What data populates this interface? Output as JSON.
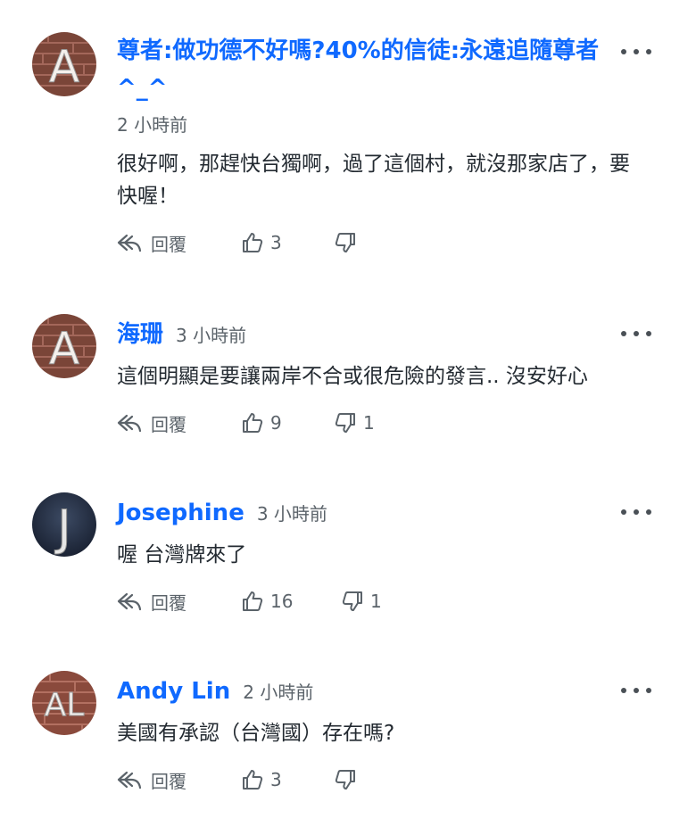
{
  "ui": {
    "reply_label": "回覆"
  },
  "comments": [
    {
      "author": "尊者:做功德不好嗎?40%的信徒:永遠追隨尊者^_^",
      "time": "2 小時前",
      "text": "很好啊，那趕快台獨啊，過了這個村，就沒那家店了，要快喔！",
      "likes": "3",
      "dislikes": "",
      "avatar_letter": "A"
    },
    {
      "author": "海珊",
      "time": "3 小時前",
      "text": "這個明顯是要讓兩岸不合或很危險的發言.. 沒安好心",
      "likes": "9",
      "dislikes": "1",
      "avatar_letter": "A"
    },
    {
      "author": "Josephine",
      "time": "3 小時前",
      "text": "喔 台灣牌來了",
      "likes": "16",
      "dislikes": "1",
      "avatar_letter": "J"
    },
    {
      "author": "Andy Lin",
      "time": "2 小時前",
      "text": "美國有承認（台灣國）存在嗎?",
      "likes": "3",
      "dislikes": "",
      "avatar_letter": "AL"
    }
  ],
  "colors": {
    "author": "#0f69ff",
    "meta": "#5b636a",
    "text": "#232a31",
    "brick": "#8a4a3c"
  },
  "icons": [
    "reply-icon",
    "thumbs-up-icon",
    "thumbs-down-icon",
    "more-options-icon"
  ]
}
